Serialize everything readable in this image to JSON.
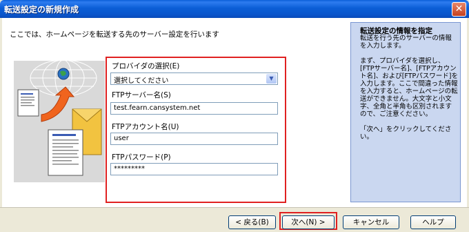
{
  "window": {
    "title": "転送設定の新規作成"
  },
  "intro_text": "ここでは、ホームページを転送する先のサーバー設定を行います",
  "form": {
    "provider_label": "プロバイダの選択(E)",
    "provider_value": "選択してください",
    "ftp_server_label": "FTPサーバー名(S)",
    "ftp_server_value": "test.fearn.cansystem.net",
    "ftp_account_label": "FTPアカウント名(U)",
    "ftp_account_value": "user",
    "ftp_password_label": "FTPパスワード(P)",
    "ftp_password_value": "*********"
  },
  "info_panel": {
    "title": "転送設定の情報を指定",
    "paragraphs": [
      "転送を行う先のサーバーの情報を入力します。",
      "まず、プロバイダを選択し、[FTPサーバー名]、[FTPアカウント名]、および[FTPパスワード]を入力します。ここで間違った情報を入力すると、ホームページの転送ができません。大文字と小文字、全角と半角も区別されますので、ご注意ください。",
      "「次へ」をクリックしてください。"
    ]
  },
  "buttons": {
    "back": "< 戻る(B)",
    "next": "次へ(N) >",
    "cancel": "キャンセル",
    "help": "ヘルプ"
  },
  "icons": {
    "close": "close-icon",
    "globe": "globe-icon",
    "document": "document-icon",
    "envelope": "envelope-icon",
    "arrow": "arrow-icon"
  },
  "colors": {
    "titlebar": "#0b5ed6",
    "highlight_border": "#e02020",
    "info_panel_bg": "#cad7f0"
  }
}
